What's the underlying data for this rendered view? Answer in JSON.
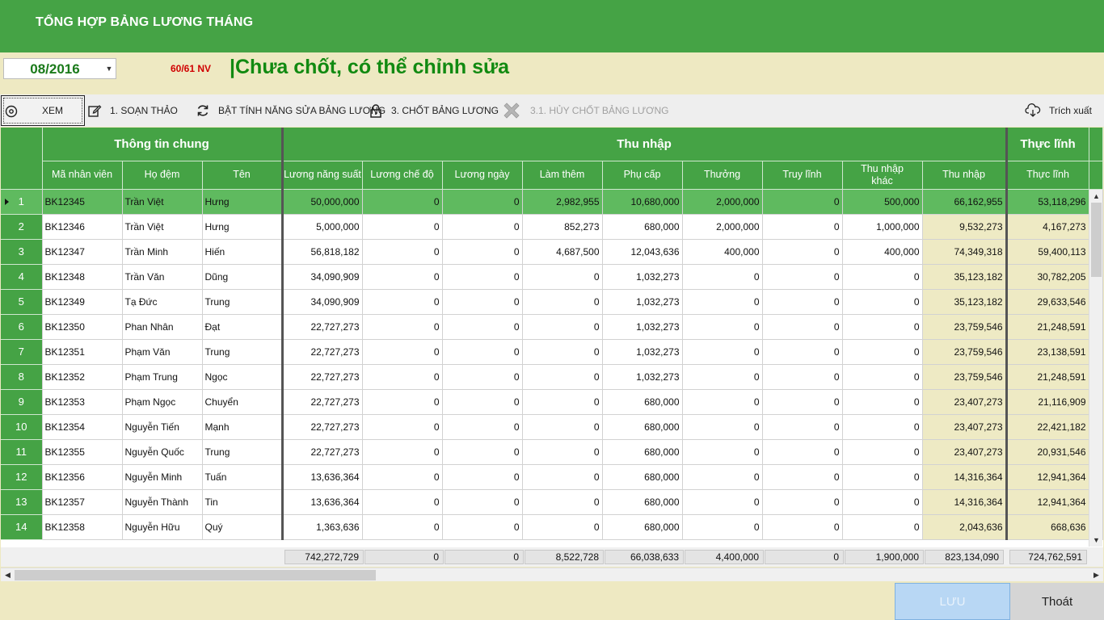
{
  "window": {
    "title": "TỔNG HỢP BẢNG LƯƠNG THÁNG"
  },
  "header": {
    "period": "08/2016",
    "employee_count": "60/61 NV",
    "status": "|Chưa chốt, có thể chỉnh sửa"
  },
  "toolbar": {
    "view": "XEM",
    "edit": "1. SOẠN THẢO",
    "enable_edit": "BẬT TÍNH NĂNG SỬA BẢNG LƯƠNG",
    "lock": "3. CHỐT BẢNG LƯƠNG",
    "unlock": "3.1. HỦY CHỐT BẢNG LƯƠNG",
    "export": "Trích xuất"
  },
  "grid": {
    "groups": {
      "general": "Thông tin chung",
      "income": "Thu nhập",
      "net": "Thực lĩnh"
    },
    "columns": {
      "emp_id": "Mã nhân viên",
      "last_name": "Họ đệm",
      "first_name": "Tên",
      "perf_salary": "Lương năng suất",
      "policy_salary": "Lương chế độ",
      "daily_salary": "Lương ngày",
      "overtime": "Làm thêm",
      "allowance": "Phụ cấp",
      "bonus": "Thưởng",
      "retro_pay": "Truy lĩnh",
      "other_income": "Thu nhập khác",
      "total_income": "Thu nhập",
      "net_pay": "Thực lĩnh"
    },
    "rows": [
      {
        "no": "1",
        "id": "BK12345",
        "last": "Trần Việt",
        "first": "Hưng",
        "v": [
          "50,000,000",
          "0",
          "0",
          "2,982,955",
          "10,680,000",
          "2,000,000",
          "0",
          "500,000",
          "66,162,955",
          "53,118,296"
        ]
      },
      {
        "no": "2",
        "id": "BK12346",
        "last": "Trần Việt",
        "first": "Hưng",
        "v": [
          "5,000,000",
          "0",
          "0",
          "852,273",
          "680,000",
          "2,000,000",
          "0",
          "1,000,000",
          "9,532,273",
          "4,167,273"
        ]
      },
      {
        "no": "3",
        "id": "BK12347",
        "last": "Trần Minh",
        "first": "Hiến",
        "v": [
          "56,818,182",
          "0",
          "0",
          "4,687,500",
          "12,043,636",
          "400,000",
          "0",
          "400,000",
          "74,349,318",
          "59,400,113"
        ]
      },
      {
        "no": "4",
        "id": "BK12348",
        "last": "Trần Văn",
        "first": "Dũng",
        "v": [
          "34,090,909",
          "0",
          "0",
          "0",
          "1,032,273",
          "0",
          "0",
          "0",
          "35,123,182",
          "30,782,205"
        ]
      },
      {
        "no": "5",
        "id": "BK12349",
        "last": "Tạ Đức",
        "first": "Trung",
        "v": [
          "34,090,909",
          "0",
          "0",
          "0",
          "1,032,273",
          "0",
          "0",
          "0",
          "35,123,182",
          "29,633,546"
        ]
      },
      {
        "no": "6",
        "id": "BK12350",
        "last": "Phan Nhân",
        "first": "Đạt",
        "v": [
          "22,727,273",
          "0",
          "0",
          "0",
          "1,032,273",
          "0",
          "0",
          "0",
          "23,759,546",
          "21,248,591"
        ]
      },
      {
        "no": "7",
        "id": "BK12351",
        "last": "Phạm Văn",
        "first": "Trung",
        "v": [
          "22,727,273",
          "0",
          "0",
          "0",
          "1,032,273",
          "0",
          "0",
          "0",
          "23,759,546",
          "23,138,591"
        ]
      },
      {
        "no": "8",
        "id": "BK12352",
        "last": "Phạm Trung",
        "first": "Ngọc",
        "v": [
          "22,727,273",
          "0",
          "0",
          "0",
          "1,032,273",
          "0",
          "0",
          "0",
          "23,759,546",
          "21,248,591"
        ]
      },
      {
        "no": "9",
        "id": "BK12353",
        "last": "Phạm Ngọc",
        "first": "Chuyển",
        "v": [
          "22,727,273",
          "0",
          "0",
          "0",
          "680,000",
          "0",
          "0",
          "0",
          "23,407,273",
          "21,116,909"
        ]
      },
      {
        "no": "10",
        "id": "BK12354",
        "last": "Nguyễn Tiến",
        "first": "Mạnh",
        "v": [
          "22,727,273",
          "0",
          "0",
          "0",
          "680,000",
          "0",
          "0",
          "0",
          "23,407,273",
          "22,421,182"
        ]
      },
      {
        "no": "11",
        "id": "BK12355",
        "last": "Nguyễn Quốc",
        "first": "Trung",
        "v": [
          "22,727,273",
          "0",
          "0",
          "0",
          "680,000",
          "0",
          "0",
          "0",
          "23,407,273",
          "20,931,546"
        ]
      },
      {
        "no": "12",
        "id": "BK12356",
        "last": "Nguyễn Minh",
        "first": "Tuấn",
        "v": [
          "13,636,364",
          "0",
          "0",
          "0",
          "680,000",
          "0",
          "0",
          "0",
          "14,316,364",
          "12,941,364"
        ]
      },
      {
        "no": "13",
        "id": "BK12357",
        "last": "Nguyễn Thành",
        "first": "Tin",
        "v": [
          "13,636,364",
          "0",
          "0",
          "0",
          "680,000",
          "0",
          "0",
          "0",
          "14,316,364",
          "12,941,364"
        ]
      },
      {
        "no": "14",
        "id": "BK12358",
        "last": "Nguyễn Hữu",
        "first": "Quý",
        "v": [
          "1,363,636",
          "0",
          "0",
          "0",
          "680,000",
          "0",
          "0",
          "0",
          "2,043,636",
          "668,636"
        ]
      }
    ],
    "totals": [
      "742,272,729",
      "0",
      "0",
      "8,522,728",
      "66,038,633",
      "4,400,000",
      "0",
      "1,900,000",
      "823,134,090",
      "724,762,591"
    ]
  },
  "footer": {
    "save": "LƯU",
    "exit": "Thoát"
  },
  "colors": {
    "brand_green": "#45a345",
    "status_green": "#118a11",
    "count_red": "#d00000",
    "highlight": "#eeeac4",
    "background": "#eee9c2"
  }
}
